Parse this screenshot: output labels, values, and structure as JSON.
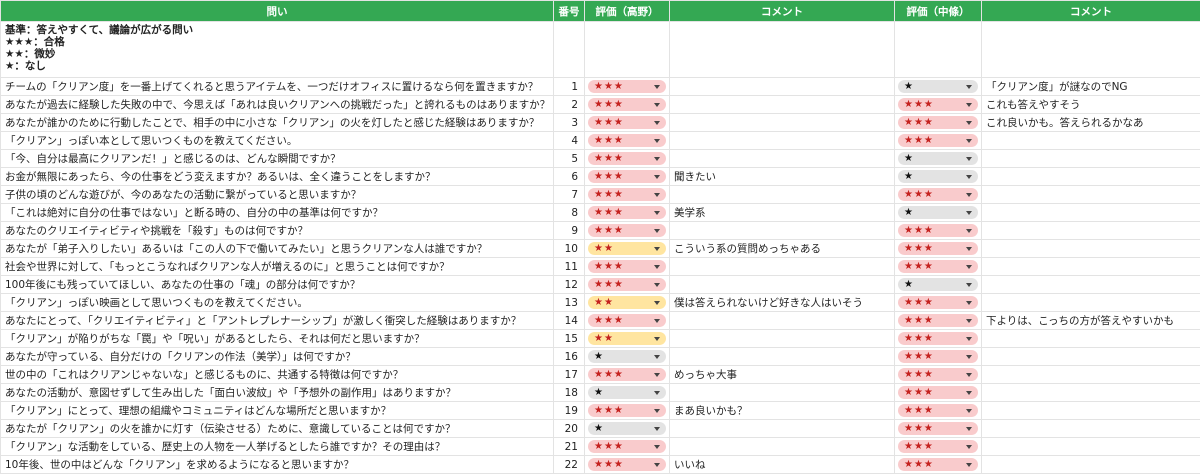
{
  "headers": {
    "question": "問い",
    "number": "番号",
    "rating_takano": "評価（高野）",
    "comment1": "コメント",
    "rating_nakajo": "評価（中條）",
    "comment2": "コメント"
  },
  "criteria": [
    "基準：答えやすくて、議論が広がる問い",
    "★★★：合格",
    "★★：微妙",
    "★：なし"
  ],
  "rows": [
    {
      "q": "チームの「クリアン度」を一番上げてくれると思うアイテムを、一つだけオフィスに置けるなら何を置きますか？",
      "n": "1",
      "r1": "★★★",
      "c1": "",
      "r2": "★",
      "c2": "「クリアン度」が謎なのでNG"
    },
    {
      "q": "あなたが過去に経験した失敗の中で、今思えば「あれは良いクリアンへの挑戦だった」と誇れるものはありますか？",
      "n": "2",
      "r1": "★★★",
      "c1": "",
      "r2": "★★★",
      "c2": "これも答えやすそう"
    },
    {
      "q": "あなたが誰かのために行動したことで、相手の中に小さな「クリアン」の火を灯したと感じた経験はありますか？",
      "n": "3",
      "r1": "★★★",
      "c1": "",
      "r2": "★★★",
      "c2": "これ良いかも。答えられるかなあ"
    },
    {
      "q": "「クリアン」っぽい本として思いつくものを教えてください。",
      "n": "4",
      "r1": "★★★",
      "c1": "",
      "r2": "★★★",
      "c2": ""
    },
    {
      "q": "「今、自分は最高にクリアンだ！」と感じるのは、どんな瞬間ですか？",
      "n": "5",
      "r1": "★★★",
      "c1": "",
      "r2": "★",
      "c2": ""
    },
    {
      "q": "お金が無限にあったら、今の仕事をどう変えますか？あるいは、全く違うことをしますか？",
      "n": "6",
      "r1": "★★★",
      "c1": "聞きたい",
      "r2": "★",
      "c2": ""
    },
    {
      "q": "子供の頃のどんな遊びが、今のあなたの活動に繋がっていると思いますか？",
      "n": "7",
      "r1": "★★★",
      "c1": "",
      "r2": "★★★",
      "c2": ""
    },
    {
      "q": "「これは絶対に自分の仕事ではない」と断る時の、自分の中の基準は何ですか？",
      "n": "8",
      "r1": "★★★",
      "c1": "美学系",
      "r2": "★",
      "c2": ""
    },
    {
      "q": "あなたのクリエイティビティや挑戦を「殺す」ものは何ですか？",
      "n": "9",
      "r1": "★★★",
      "c1": "",
      "r2": "★★★",
      "c2": ""
    },
    {
      "q": "あなたが「弟子入りしたい」あるいは「この人の下で働いてみたい」と思うクリアンな人は誰ですか？",
      "n": "10",
      "r1": "★★",
      "c1": "こういう系の質問めっちゃある",
      "r2": "★★★",
      "c2": ""
    },
    {
      "q": "社会や世界に対して、「もっとこうなればクリアンな人が増えるのに」と思うことは何ですか？",
      "n": "11",
      "r1": "★★★",
      "c1": "",
      "r2": "★★★",
      "c2": ""
    },
    {
      "q": "100年後にも残っていてほしい、あなたの仕事の「魂」の部分は何ですか？",
      "n": "12",
      "r1": "★★★",
      "c1": "",
      "r2": "★",
      "c2": ""
    },
    {
      "q": "「クリアン」っぽい映画として思いつくものを教えてください。",
      "n": "13",
      "r1": "★★",
      "c1": "僕は答えられないけど好きな人はいそう",
      "r2": "★★★",
      "c2": ""
    },
    {
      "q": "あなたにとって、「クリエイティビティ」と「アントレプレナーシップ」が激しく衝突した経験はありますか？",
      "n": "14",
      "r1": "★★★",
      "c1": "",
      "r2": "★★★",
      "c2": "下よりは、こっちの方が答えやすいかも"
    },
    {
      "q": "「クリアン」が陥りがちな「罠」や「呪い」があるとしたら、それは何だと思いますか？",
      "n": "15",
      "r1": "★★",
      "c1": "",
      "r2": "★★★",
      "c2": ""
    },
    {
      "q": "あなたが守っている、自分だけの「クリアンの作法（美学）」は何ですか？",
      "n": "16",
      "r1": "★",
      "c1": "",
      "r2": "★★★",
      "c2": ""
    },
    {
      "q": "世の中の「これはクリアンじゃないな」と感じるものに、共通する特徴は何ですか？",
      "n": "17",
      "r1": "★★★",
      "c1": "めっちゃ大事",
      "r2": "★★★",
      "c2": ""
    },
    {
      "q": "あなたの活動が、意図せずして生み出した「面白い波紋」や「予想外の副作用」はありますか？",
      "n": "18",
      "r1": "★",
      "c1": "",
      "r2": "★★★",
      "c2": ""
    },
    {
      "q": "「クリアン」にとって、理想の組織やコミュニティはどんな場所だと思いますか？",
      "n": "19",
      "r1": "★★★",
      "c1": "まあ良いかも？",
      "r2": "★★★",
      "c2": ""
    },
    {
      "q": "あなたが「クリアン」の火を誰かに灯す（伝染させる）ために、意識していることは何ですか？",
      "n": "20",
      "r1": "★",
      "c1": "",
      "r2": "★★★",
      "c2": ""
    },
    {
      "q": "「クリアン」な活動をしている、歴史上の人物を一人挙げるとしたら誰ですか？その理由は？",
      "n": "21",
      "r1": "★★★",
      "c1": "",
      "r2": "★★★",
      "c2": ""
    },
    {
      "q": "10年後、世の中はどんな「クリアン」を求めるようになると思いますか？",
      "n": "22",
      "r1": "★★★",
      "c1": "いいね",
      "r2": "★★★",
      "c2": ""
    }
  ]
}
